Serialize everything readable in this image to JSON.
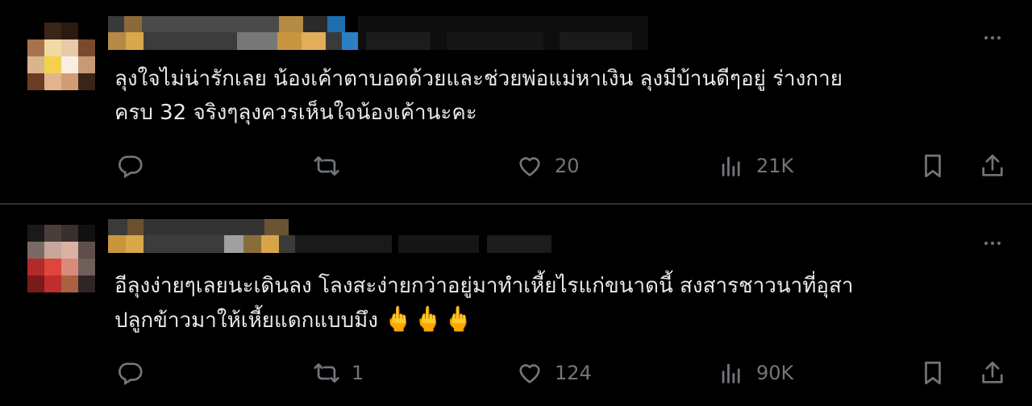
{
  "tweets": [
    {
      "text_line1": "ลุงใจไม่น่ารักเลย น้องเค้าตาบอดด้วยและช่วยพ่อแม่หาเงิน ลุงมีบ้านดีๆอยู่ ร่างกาย",
      "text_line2": "ครบ 32 จริงๆลุงควรเห็นใจน้องเค้านะคะ",
      "emoji": "",
      "reply_count": "",
      "retweet_count": "",
      "like_count": "20",
      "view_count": "21K"
    },
    {
      "text_line1": "อีลุงง่ายๆเลยนะเดินลง โลงสะง่ายกว่าอยู่มาทำเหี้ยไรแก่ขนาดนี้ สงสารชาวนาที่อุสา",
      "text_line2": "ปลูกข้าวมาให้เหี้ยแดกแบบมึง",
      "emoji": "🖕🖕🖕",
      "reply_count": "",
      "retweet_count": "1",
      "like_count": "124",
      "view_count": "90K"
    }
  ],
  "icons": {
    "reply": "reply-icon",
    "retweet": "retweet-icon",
    "like": "like-icon",
    "views": "views-icon",
    "bookmark": "bookmark-icon",
    "share": "share-icon",
    "more": "more-icon"
  },
  "colors": {
    "background": "#000000",
    "text": "#e7e9ea",
    "secondary": "#71767b",
    "divider": "#2f3336"
  }
}
